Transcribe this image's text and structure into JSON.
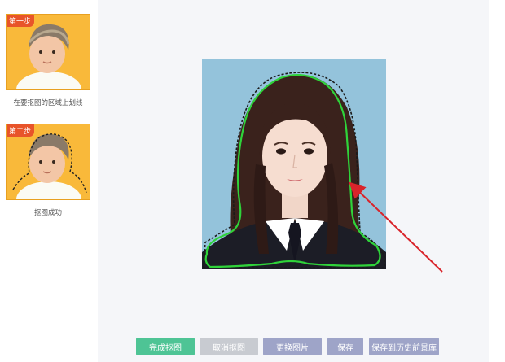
{
  "steps": [
    {
      "badge": "第一步",
      "caption": "在要抠图的区域上划线"
    },
    {
      "badge": "第二步",
      "caption": "抠图成功"
    }
  ],
  "toolbar": {
    "finish_label": "完成抠图",
    "cancel_label": "取消抠图",
    "replace_label": "更换图片",
    "save_label": "保存",
    "save_history_label": "保存到历史前景库"
  },
  "colors": {
    "finish": "#4ec495",
    "cancel": "#c8cbd1",
    "action": "#9ea4c8",
    "stroke": "#2fd33a",
    "arrow": "#d9242b",
    "photo_bg": "#94c3db"
  },
  "icons": [
    "arrow-pointer",
    "cutout-stroke"
  ]
}
